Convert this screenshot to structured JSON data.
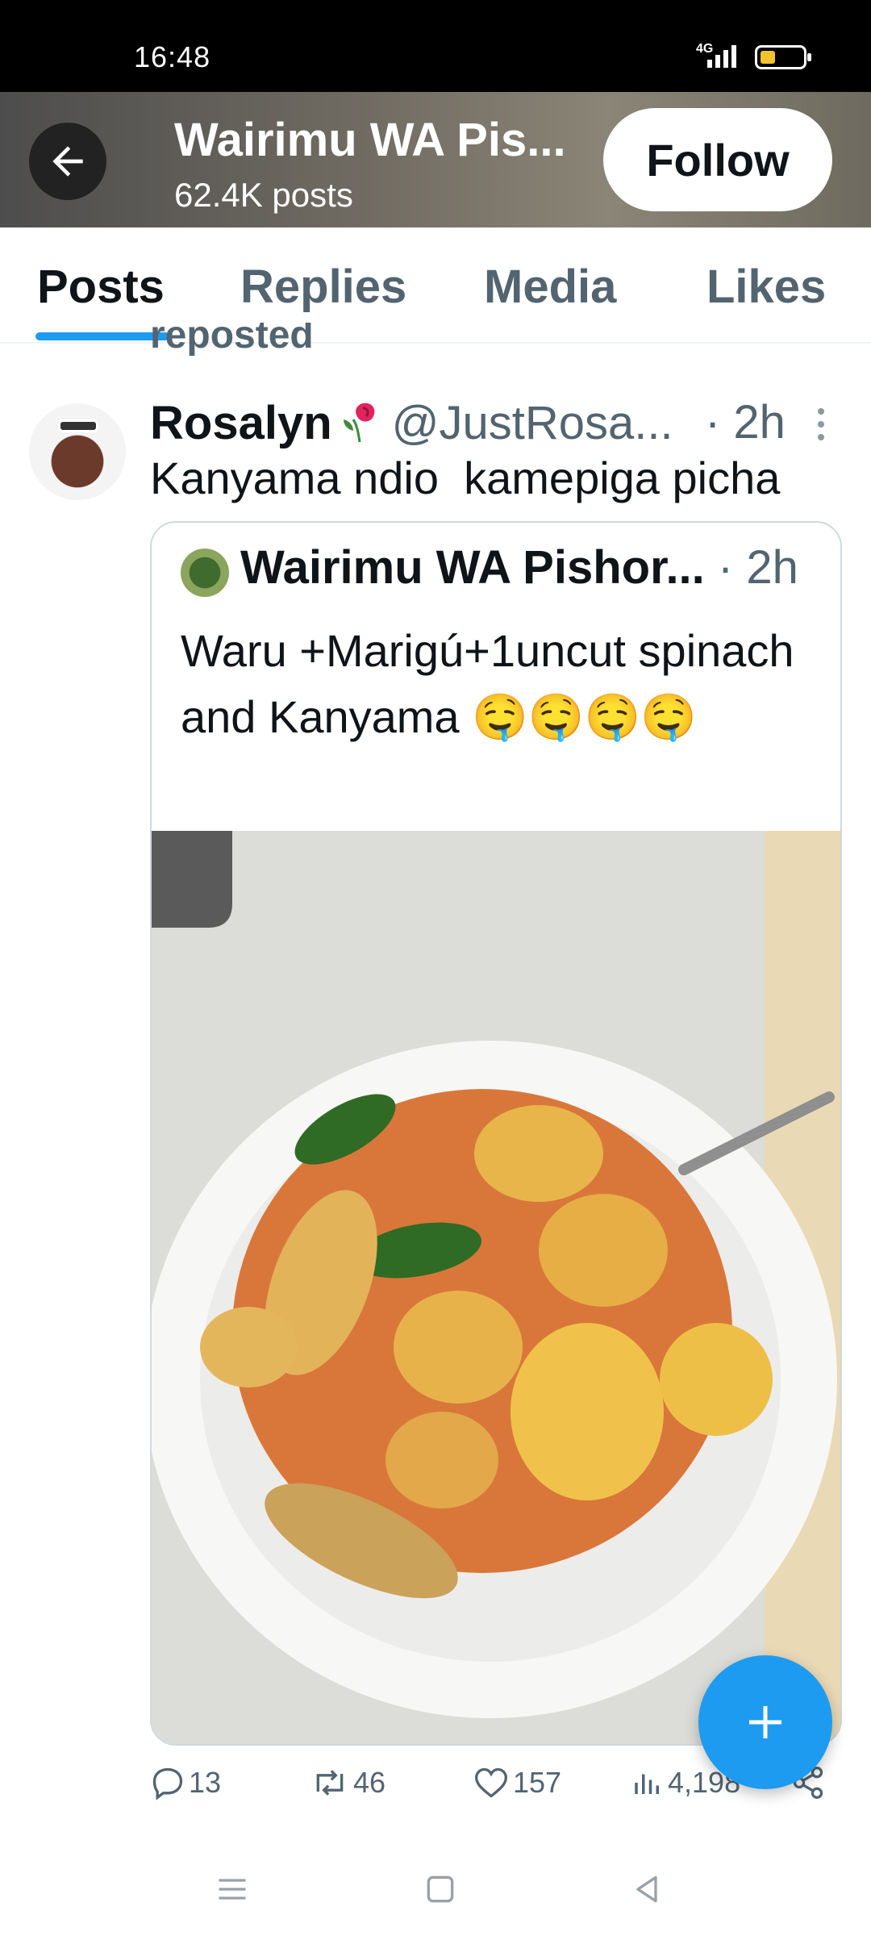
{
  "status_bar": {
    "time": "16:48",
    "network": "4G"
  },
  "header": {
    "title": "Wairimu WA Pis...",
    "subtitle": "62.4K posts",
    "follow_label": "Follow"
  },
  "tabs": [
    {
      "label": "Posts",
      "active": true
    },
    {
      "label": "Replies",
      "active": false
    },
    {
      "label": "Media",
      "active": false
    },
    {
      "label": "Likes",
      "active": false
    }
  ],
  "post": {
    "reposted_label": "reposted",
    "author_name": "Rosalyn",
    "author_handle": "@JustRosa...",
    "time": "· 2h",
    "text": "Kanyama ndio  kamepiga picha",
    "quote": {
      "author_name": "Wairimu WA Pishor...",
      "time": " · 2h",
      "text": "Waru +Marigú+1uncut spinach and Kanyama 🤤🤤🤤🤤",
      "image_description_icon": "food-plate"
    },
    "actions": {
      "replies": "13",
      "reposts": "46",
      "likes": "157",
      "views": "4,198"
    }
  },
  "colors": {
    "accent": "#1d9bf0",
    "secondary_text": "#536471",
    "primary_text": "#0f1419"
  }
}
